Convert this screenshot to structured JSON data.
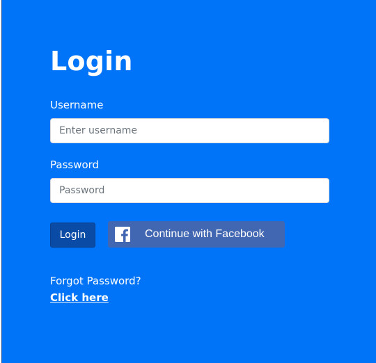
{
  "login_form": {
    "title": "Login",
    "username_label": "Username",
    "username_placeholder": "Enter username",
    "password_label": "Password",
    "password_placeholder": "Password",
    "login_button_label": "Login",
    "facebook_button_label": "Continue with Facebook",
    "forgot_password_text": "Forgot Password?",
    "forgot_password_link": "Click here"
  },
  "colors": {
    "panel_background": "#0074f8",
    "login_button": "#0a4ba5",
    "facebook_button": "#4267b2",
    "text": "#ffffff"
  },
  "icons": {
    "facebook": "facebook-icon"
  }
}
